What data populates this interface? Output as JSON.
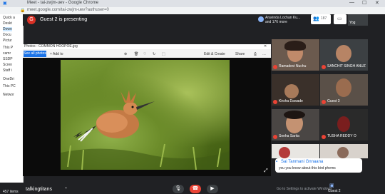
{
  "browser": {
    "title": "Meet - tai-zwjm-uev - Google Chrome",
    "url": "meet.google.com/tai-zwjm-uev?authuser=0",
    "controls": [
      "—",
      "☐",
      "✕"
    ]
  },
  "explorer": {
    "items": [
      "Quick a",
      "Deskt",
      "Down",
      "Docu",
      "Pictur",
      "This P",
      "camr",
      "SSDP",
      "Scren",
      "Staff i",
      "OneDri",
      "This PC",
      "Networ"
    ],
    "item_count": "457 items"
  },
  "meet": {
    "avatar_letter": "G",
    "presenting_text": "Guest 2 is presenting",
    "participants_line1": "Aravinda Lochan Ku...",
    "participants_line2": "and 176 more",
    "people_count": "187",
    "tile_label_top": "Yog"
  },
  "photos": {
    "window_title": "Photos - COMMON HOOPOE.jpg",
    "see_all": "See all photos",
    "add_to": "+ Add to",
    "edit_create": "Edit & Create",
    "share": "Share",
    "icons": [
      "zoom-icon",
      "delete-icon",
      "favorite-icon",
      "rotate-icon",
      "crop-icon"
    ]
  },
  "tiles": [
    {
      "name": "Ramadevi Nuchu"
    },
    {
      "name": "SANCHIT SINGH ANUZ"
    },
    {
      "name": "Kirsha Dawade"
    },
    {
      "name": "Guest 3"
    },
    {
      "name": "Sneha Sarita"
    },
    {
      "name": "TUSHA REDDY O"
    },
    {
      "name": ""
    },
    {
      "name": ""
    }
  ],
  "chat": {
    "sender": "Sai Tanmani Gnnaana",
    "message": "you you know about this bird phems"
  },
  "bottom": {
    "meeting_name": "talkingtitans",
    "present_now": "Guest 2",
    "activate_windows": "Go to Settings to activate Windows"
  }
}
